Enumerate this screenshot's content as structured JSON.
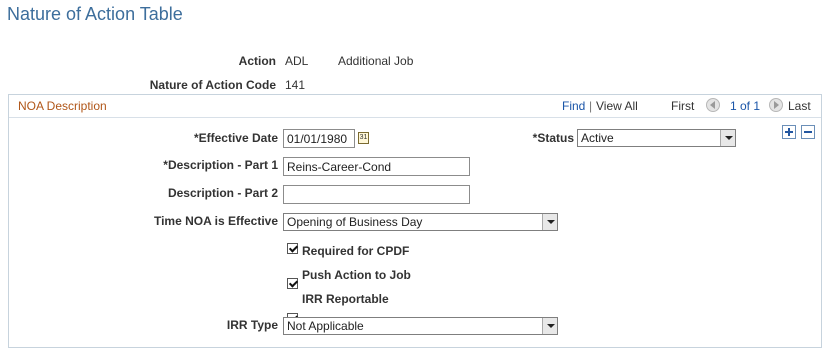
{
  "page": {
    "title": "Nature of Action Table"
  },
  "header": {
    "action_label": "Action",
    "action_code": "ADL",
    "action_desc": "Additional Job",
    "noa_code_label": "Nature of Action Code",
    "noa_code_value": "141"
  },
  "group": {
    "title": "NOA Description",
    "find_label": "Find",
    "view_all_label": "View All",
    "first_label": "First",
    "page_count": "1 of 1",
    "last_label": "Last",
    "separator": "|"
  },
  "form": {
    "effective_date": {
      "label": "*Effective Date",
      "value": "01/01/1980",
      "calendar_glyph": "31"
    },
    "status": {
      "label": "*Status",
      "value": "Active"
    },
    "desc1": {
      "label": "*Description - Part 1",
      "value": "Reins-Career-Cond"
    },
    "desc2": {
      "label": "Description - Part 2",
      "value": ""
    },
    "time_noa": {
      "label": "Time NOA is Effective",
      "value": "Opening of Business Day"
    },
    "required_cpdf": {
      "label": "Required for CPDF",
      "checked": true
    },
    "push_action": {
      "label": "Push Action to Job",
      "checked": true
    },
    "irr_reportable": {
      "label": "IRR Reportable",
      "checked": true
    },
    "irr_type": {
      "label": "IRR Type",
      "value": "Not Applicable"
    }
  },
  "icons": {
    "calendar": "calendar-icon",
    "first": "arrow-left-icon",
    "last": "arrow-right-icon",
    "add": "plus-icon",
    "delete": "minus-icon",
    "dropdown": "chevron-down-icon"
  }
}
